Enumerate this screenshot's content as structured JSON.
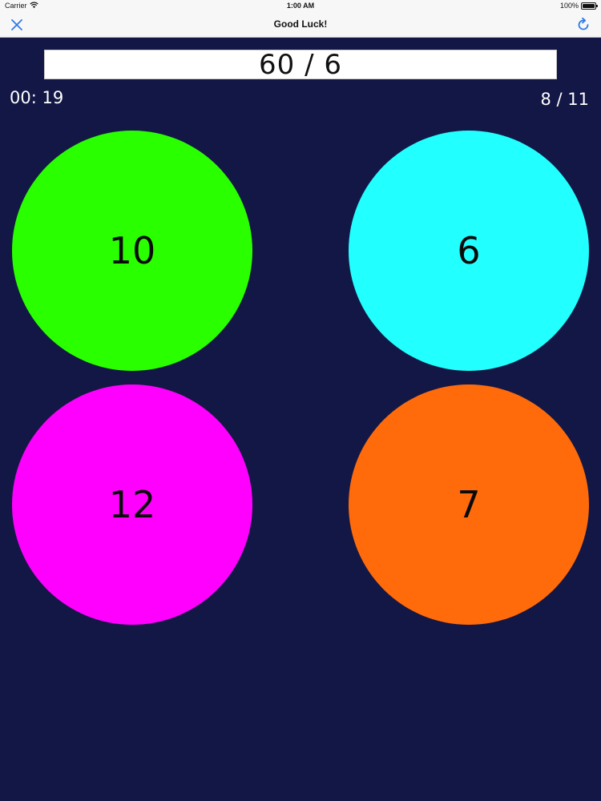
{
  "status_bar": {
    "carrier": "Carrier",
    "time": "1:00 AM",
    "battery": "100%"
  },
  "nav": {
    "title": "Good Luck!",
    "left_icon": "close-icon",
    "right_icon": "refresh-icon",
    "accent_color": "#2f7ae5"
  },
  "game": {
    "problem": "60 / 6",
    "timer": "00: 19",
    "progress": "8 / 11",
    "background_color": "#131745",
    "answers": [
      {
        "label": "10",
        "color": "#2aff00"
      },
      {
        "label": "6",
        "color": "#22ffff"
      },
      {
        "label": "12",
        "color": "#ff00ff"
      },
      {
        "label": "7",
        "color": "#ff6b0a"
      }
    ]
  }
}
